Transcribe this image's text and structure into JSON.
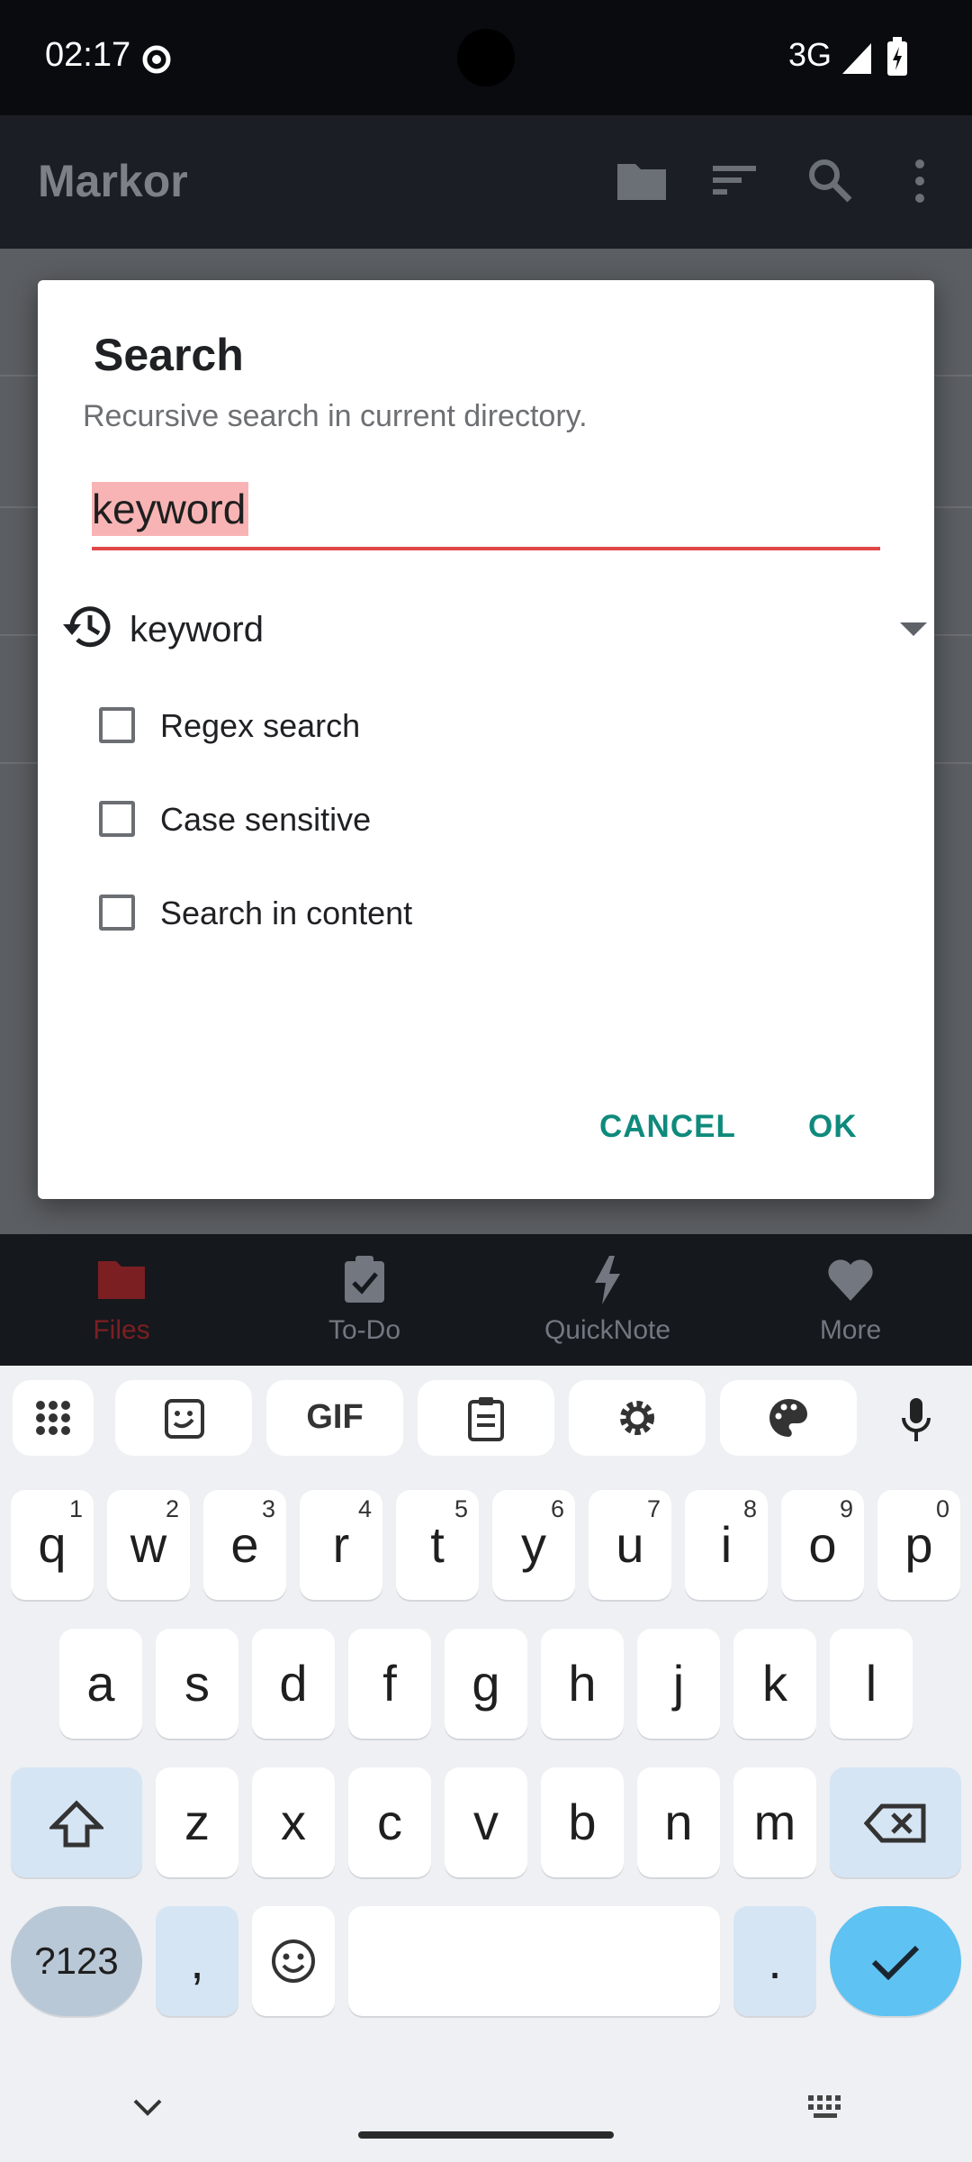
{
  "status_bar": {
    "time": "02:17",
    "network": "3G"
  },
  "app_bar": {
    "title": "Markor"
  },
  "dialog": {
    "title": "Search",
    "subtitle": "Recursive search in current directory.",
    "search_value": "keyword",
    "history_value": "keyword",
    "options": [
      {
        "label": "Regex search",
        "checked": false
      },
      {
        "label": "Case sensitive",
        "checked": false
      },
      {
        "label": "Search in content",
        "checked": false
      }
    ],
    "cancel_label": "CANCEL",
    "ok_label": "OK"
  },
  "bottom_nav": {
    "items": [
      {
        "label": "Files",
        "icon": "folder-icon",
        "active": true
      },
      {
        "label": "To-Do",
        "icon": "todo-clipboard-icon",
        "active": false
      },
      {
        "label": "QuickNote",
        "icon": "bolt-icon",
        "active": false
      },
      {
        "label": "More",
        "icon": "heart-icon",
        "active": false
      }
    ]
  },
  "keyboard": {
    "row1": [
      "q",
      "w",
      "e",
      "r",
      "t",
      "y",
      "u",
      "i",
      "o",
      "p"
    ],
    "row1_numbers": [
      "1",
      "2",
      "3",
      "4",
      "5",
      "6",
      "7",
      "8",
      "9",
      "0"
    ],
    "row2": [
      "a",
      "s",
      "d",
      "f",
      "g",
      "h",
      "j",
      "k",
      "l"
    ],
    "row3": [
      "z",
      "x",
      "c",
      "v",
      "b",
      "n",
      "m"
    ],
    "symbols_label": "?123",
    "comma": ",",
    "period": "."
  },
  "colors": {
    "accent": "#0e8a7c",
    "error_underline": "#e04848",
    "active_nav": "#7c1f22"
  }
}
